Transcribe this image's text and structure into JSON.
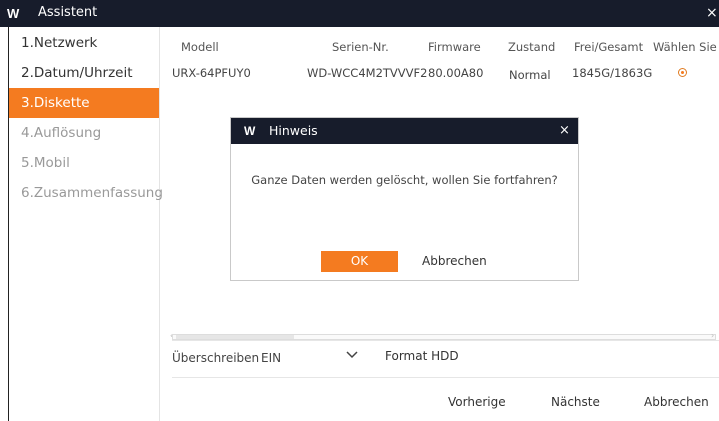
{
  "window": {
    "title": "Assistent",
    "logo": "W",
    "close": "×"
  },
  "sidebar": {
    "items": [
      {
        "label": "1.Netzwerk"
      },
      {
        "label": "2.Datum/Uhrzeit"
      },
      {
        "label": "3.Diskette"
      },
      {
        "label": "4.Auflösung"
      },
      {
        "label": "5.Mobil"
      },
      {
        "label": "6.Zusammenfassung"
      }
    ]
  },
  "table": {
    "columns": [
      "Modell",
      "Serien-Nr.",
      "Firmware",
      "Zustand",
      "Frei/Gesamt",
      "Wählen Sie"
    ],
    "rows": [
      {
        "modell": "URX-64PFUY0",
        "serien": "WD-WCC4M2TVVVF2",
        "firmware": "80.00A80",
        "zustand": "Normal",
        "frei": "1845G/1863G",
        "selected": true
      }
    ]
  },
  "options": {
    "overwrite_label": "Überschreiben",
    "overwrite_value": "EIN",
    "format_button": "Format HDD"
  },
  "footer": {
    "prev": "Vorherige",
    "next": "Nächste",
    "cancel": "Abbrechen"
  },
  "dialog": {
    "logo": "W",
    "title": "Hinweis",
    "close": "×",
    "message": "Ganze Daten werden gelöscht, wollen Sie fortfahren?",
    "ok": "OK",
    "cancel": "Abbrechen"
  },
  "colors": {
    "accent": "#f47b20",
    "titlebar": "#171c2b"
  }
}
